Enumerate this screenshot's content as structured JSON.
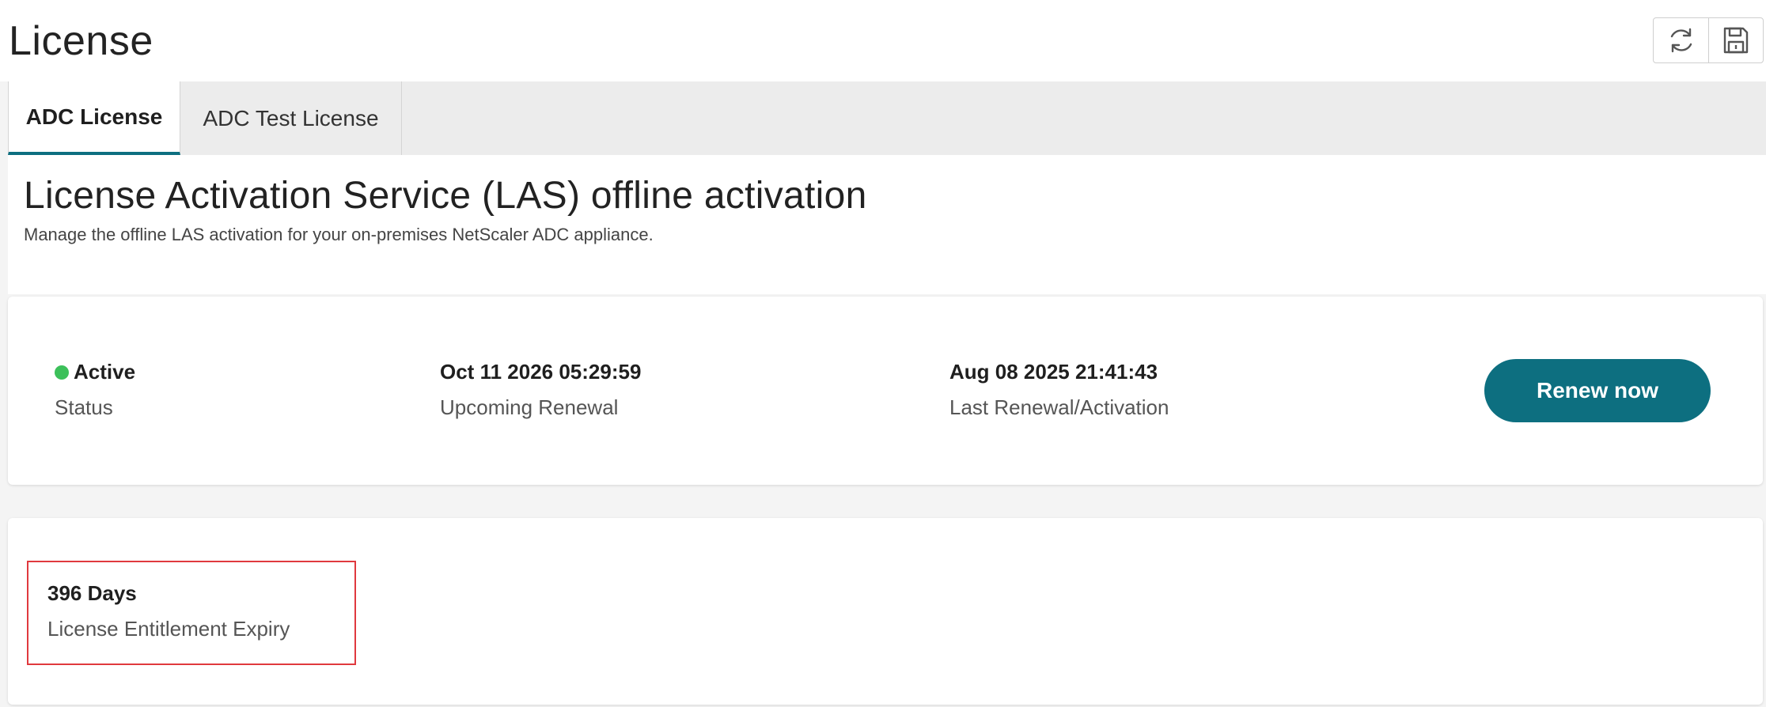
{
  "page": {
    "title": "License"
  },
  "toolbar": {
    "refresh_icon": "refresh-icon",
    "save_icon": "save-icon"
  },
  "tabs": [
    {
      "label": "ADC License",
      "active": true
    },
    {
      "label": "ADC Test License",
      "active": false
    }
  ],
  "section": {
    "title": "License Activation Service (LAS) offline activation",
    "subtitle": "Manage the offline LAS activation for your on-premises NetScaler ADC appliance."
  },
  "status_card": {
    "status": {
      "value": "Active",
      "label": "Status",
      "dot_color": "#3cc05a"
    },
    "upcoming_renewal": {
      "value": "Oct 11 2026 05:29:59",
      "label": "Upcoming Renewal"
    },
    "last_renewal": {
      "value": "Aug 08 2025 21:41:43",
      "label": "Last Renewal/Activation"
    },
    "renew_button": "Renew now"
  },
  "expiry_card": {
    "value": "396 Days",
    "label": "License Entitlement Expiry",
    "highlight_color": "#e0393e"
  },
  "colors": {
    "accent": "#0d6f80",
    "status_active": "#3cc05a"
  }
}
